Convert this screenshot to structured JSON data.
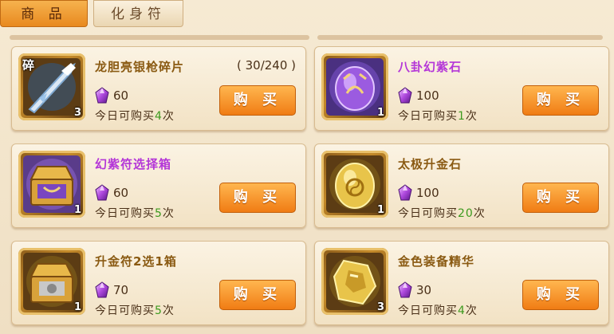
{
  "tabs": [
    "商 品",
    "化身符"
  ],
  "active_tab": 0,
  "currency_icon": "purple-gem-icon",
  "buy_label": "购 买",
  "limit_prefix": "今日可购买",
  "limit_suffix": "次",
  "colors": {
    "name_gold": "#8a5a12",
    "name_purple": "#b436d8",
    "limit_number": "#3c9a1e",
    "button": "#f07c14"
  },
  "items": [
    {
      "name": "龙胆亮银枪碎片",
      "name_color": "#8a5a12",
      "progress": "( 30/240 )",
      "price": "60",
      "limit_count": "4",
      "stack": "3",
      "fragment_tag": "碎",
      "icon": "silver-spear-icon",
      "icon_bg": "#6a4a18"
    },
    {
      "name": "八卦幻紫石",
      "name_color": "#b436d8",
      "progress": "",
      "price": "100",
      "limit_count": "1",
      "stack": "1",
      "fragment_tag": "",
      "icon": "purple-bagua-stone-icon",
      "icon_bg": "#5a3c8a"
    },
    {
      "name": "幻紫符选择箱",
      "name_color": "#b436d8",
      "progress": "",
      "price": "60",
      "limit_count": "5",
      "stack": "1",
      "fragment_tag": "",
      "icon": "purple-chest-icon",
      "icon_bg": "#6a4a9a"
    },
    {
      "name": "太极升金石",
      "name_color": "#8a5a12",
      "progress": "",
      "price": "100",
      "limit_count": "20",
      "stack": "1",
      "fragment_tag": "",
      "icon": "gold-taiji-stone-icon",
      "icon_bg": "#6a4a18"
    },
    {
      "name": "升金符2选1箱",
      "name_color": "#8a5a12",
      "progress": "",
      "price": "70",
      "limit_count": "5",
      "stack": "1",
      "fragment_tag": "",
      "icon": "gold-chest-icon",
      "icon_bg": "#6a4a18"
    },
    {
      "name": "金色装备精华",
      "name_color": "#8a5a12",
      "progress": "",
      "price": "30",
      "limit_count": "4",
      "stack": "3",
      "fragment_tag": "",
      "icon": "gold-essence-icon",
      "icon_bg": "#6a4a18"
    }
  ]
}
